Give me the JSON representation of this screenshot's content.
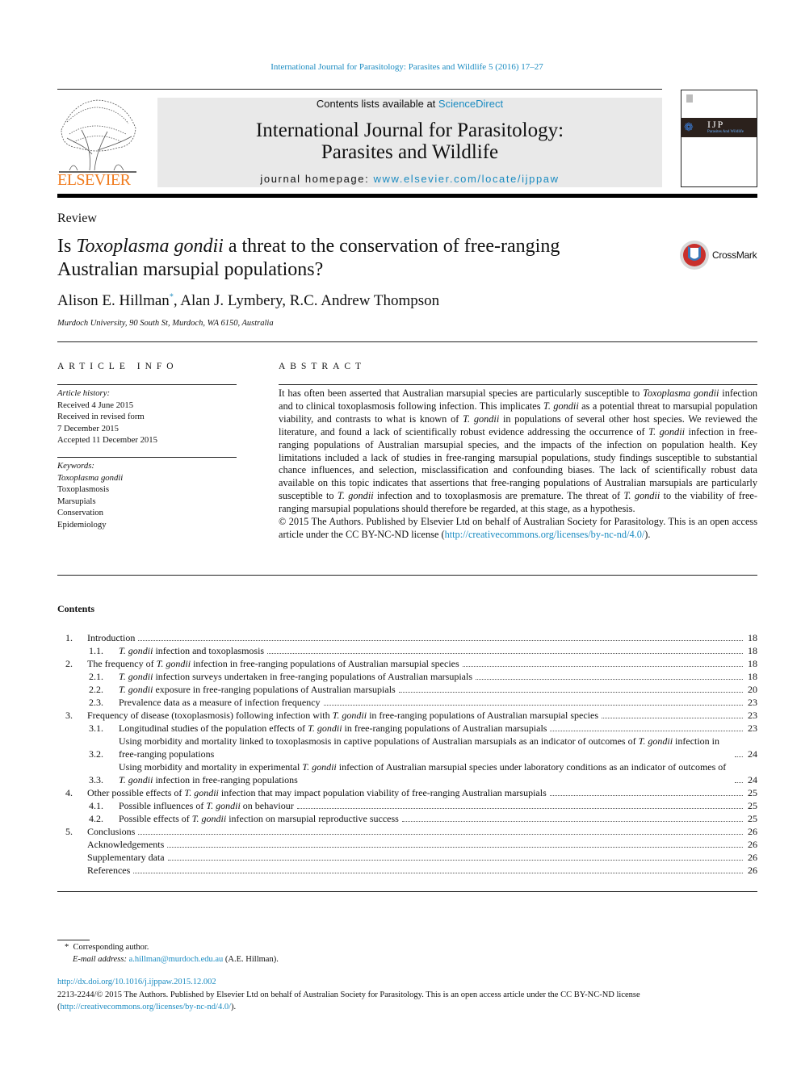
{
  "running_header": "International Journal for Parasitology: Parasites and Wildlife 5 (2016) 17–27",
  "publisher_logo": {
    "text": "ELSEVIER",
    "color": "#f07a1c"
  },
  "journal_box": {
    "contents_prefix": "Contents lists available at ",
    "sciencedirect": "ScienceDirect",
    "title_line1": "International Journal for Parasitology:",
    "title_line2": "Parasites and Wildlife",
    "homepage_prefix": "journal homepage: ",
    "homepage_url": "www.elsevier.com/locate/ijppaw"
  },
  "cover": {
    "text": "IJP",
    "subtitle": "Parasites And Wildlife"
  },
  "article_type": "Review",
  "title": [
    {
      "t": "Is "
    },
    {
      "t": "Toxoplasma gondii",
      "i": true
    },
    {
      "t": " a threat to the conservation of free-ranging Australian marsupial populations?"
    }
  ],
  "crossmark": "CrossMark",
  "authors": {
    "a1": "Alison E. Hillman",
    "a1_mark": "*",
    "rest": ", Alan J. Lymbery, R.C. Andrew Thompson"
  },
  "affiliation": "Murdoch University, 90 South St, Murdoch, WA 6150, Australia",
  "article_info": {
    "heading": "ARTICLE INFO",
    "history_label": "Article history:",
    "history": [
      "Received 4 June 2015",
      "Received in revised form",
      "7 December 2015",
      "Accepted 11 December 2015"
    ],
    "keywords_label": "Keywords:",
    "keywords": [
      "Toxoplasma gondii",
      "Toxoplasmosis",
      "Marsupials",
      "Conservation",
      "Epidemiology"
    ]
  },
  "abstract": {
    "heading": "ABSTRACT",
    "body": [
      {
        "t": "It has often been asserted that Australian marsupial species are particularly susceptible to "
      },
      {
        "t": "Toxoplasma gondii",
        "i": true
      },
      {
        "t": " infection and to clinical toxoplasmosis following infection. This implicates "
      },
      {
        "t": "T. gondii",
        "i": true
      },
      {
        "t": " as a potential threat to marsupial population viability, and contrasts to what is known of "
      },
      {
        "t": "T. gondii",
        "i": true
      },
      {
        "t": " in populations of several other host species. We reviewed the literature, and found a lack of scientifically robust evidence addressing the occurrence of "
      },
      {
        "t": "T. gondii",
        "i": true
      },
      {
        "t": " infection in free-ranging populations of Australian marsupial species, and the impacts of the infection on population health. Key limitations included a lack of studies in free-ranging marsupial populations, study findings susceptible to substantial chance influences, and selection, misclassification and confounding biases. The lack of scientifically robust data available on this topic indicates that assertions that free-ranging populations of Australian marsupials are particularly susceptible to "
      },
      {
        "t": "T. gondii",
        "i": true
      },
      {
        "t": " infection and to toxoplasmosis are premature. The threat of "
      },
      {
        "t": "T. gondii",
        "i": true
      },
      {
        "t": " to the viability of free-ranging marsupial populations should therefore be regarded, at this stage, as a hypothesis."
      }
    ],
    "copyright": [
      {
        "t": "© 2015 The Authors. Published by Elsevier Ltd on behalf of Australian Society for Parasitology. This is an open access article under the CC BY-NC-ND license ("
      },
      {
        "t": "http://creativecommons.org/licenses/by-nc-nd/4.0/",
        "link": true
      },
      {
        "t": ")."
      }
    ]
  },
  "contents": {
    "heading": "Contents",
    "entries": [
      {
        "num": "1.",
        "level": 1,
        "page": "18",
        "text": [
          {
            "t": "Introduction"
          }
        ]
      },
      {
        "num": "1.1.",
        "level": 2,
        "page": "18",
        "text": [
          {
            "t": "T. gondii",
            "i": true
          },
          {
            "t": " infection and toxoplasmosis"
          }
        ]
      },
      {
        "num": "2.",
        "level": 1,
        "page": "18",
        "text": [
          {
            "t": "The frequency of "
          },
          {
            "t": "T. gondii",
            "i": true
          },
          {
            "t": " infection in free-ranging populations of Australian marsupial species"
          }
        ]
      },
      {
        "num": "2.1.",
        "level": 2,
        "page": "18",
        "text": [
          {
            "t": "T. gondii",
            "i": true
          },
          {
            "t": " infection surveys undertaken in free-ranging populations of Australian marsupials"
          }
        ]
      },
      {
        "num": "2.2.",
        "level": 2,
        "page": "20",
        "text": [
          {
            "t": "T. gondii",
            "i": true
          },
          {
            "t": " exposure in free-ranging populations of Australian marsupials"
          }
        ]
      },
      {
        "num": "2.3.",
        "level": 2,
        "page": "23",
        "text": [
          {
            "t": "Prevalence data as a measure of infection frequency"
          }
        ]
      },
      {
        "num": "3.",
        "level": 1,
        "page": "23",
        "text": [
          {
            "t": "Frequency of disease (toxoplasmosis) following infection with "
          },
          {
            "t": "T. gondii",
            "i": true
          },
          {
            "t": " in free-ranging populations of Australian marsupial species"
          }
        ]
      },
      {
        "num": "3.1.",
        "level": 2,
        "page": "23",
        "text": [
          {
            "t": "Longitudinal studies of the population effects of "
          },
          {
            "t": "T. gondii",
            "i": true
          },
          {
            "t": " in free-ranging populations of Australian marsupials"
          }
        ]
      },
      {
        "num": "3.2.",
        "level": 2,
        "page": "24",
        "text": [
          {
            "t": "Using morbidity and mortality linked to toxoplasmosis in captive populations of Australian marsupials as an indicator of outcomes of "
          },
          {
            "t": "T. gondii",
            "i": true
          },
          {
            "t": " infection in free-ranging populations"
          }
        ]
      },
      {
        "num": "3.3.",
        "level": 2,
        "page": "24",
        "text": [
          {
            "t": "Using morbidity and mortality in experimental "
          },
          {
            "t": "T. gondii",
            "i": true
          },
          {
            "t": " infection of Australian marsupial species under laboratory conditions as an indicator of outcomes of "
          },
          {
            "t": "T. gondii",
            "i": true
          },
          {
            "t": " infection in free-ranging populations"
          }
        ]
      },
      {
        "num": "4.",
        "level": 1,
        "page": "25",
        "text": [
          {
            "t": "Other possible effects of "
          },
          {
            "t": "T. gondii",
            "i": true
          },
          {
            "t": " infection that may impact population viability of free-ranging Australian marsupials"
          }
        ]
      },
      {
        "num": "4.1.",
        "level": 2,
        "page": "25",
        "text": [
          {
            "t": "Possible influences of "
          },
          {
            "t": "T. gondii",
            "i": true
          },
          {
            "t": " on behaviour"
          }
        ]
      },
      {
        "num": "4.2.",
        "level": 2,
        "page": "25",
        "text": [
          {
            "t": "Possible effects of "
          },
          {
            "t": "T. gondii",
            "i": true
          },
          {
            "t": " infection on marsupial reproductive success"
          }
        ]
      },
      {
        "num": "5.",
        "level": 1,
        "page": "26",
        "text": [
          {
            "t": "Conclusions"
          }
        ]
      },
      {
        "num": "",
        "level": 1,
        "page": "26",
        "text": [
          {
            "t": "Acknowledgements"
          }
        ]
      },
      {
        "num": "",
        "level": 1,
        "page": "26",
        "text": [
          {
            "t": "Supplementary data"
          }
        ]
      },
      {
        "num": "",
        "level": 1,
        "page": "26",
        "text": [
          {
            "t": "References"
          }
        ]
      }
    ]
  },
  "footnote": {
    "mark": "*",
    "corresponding": "Corresponding author.",
    "email_label": "E-mail address:",
    "email": "a.hillman@murdoch.edu.au",
    "email_owner": "(A.E. Hillman)."
  },
  "doi": "http://dx.doi.org/10.1016/j.ijppaw.2015.12.002",
  "license": [
    {
      "t": "2213-2244/© 2015 The Authors. Published by Elsevier Ltd on behalf of Australian Society for Parasitology. This is an open access article under the CC BY-NC-ND license ("
    },
    {
      "t": "http://creativecommons.org/licenses/by-nc-nd/4.0/",
      "link": true
    },
    {
      "t": ")."
    }
  ]
}
